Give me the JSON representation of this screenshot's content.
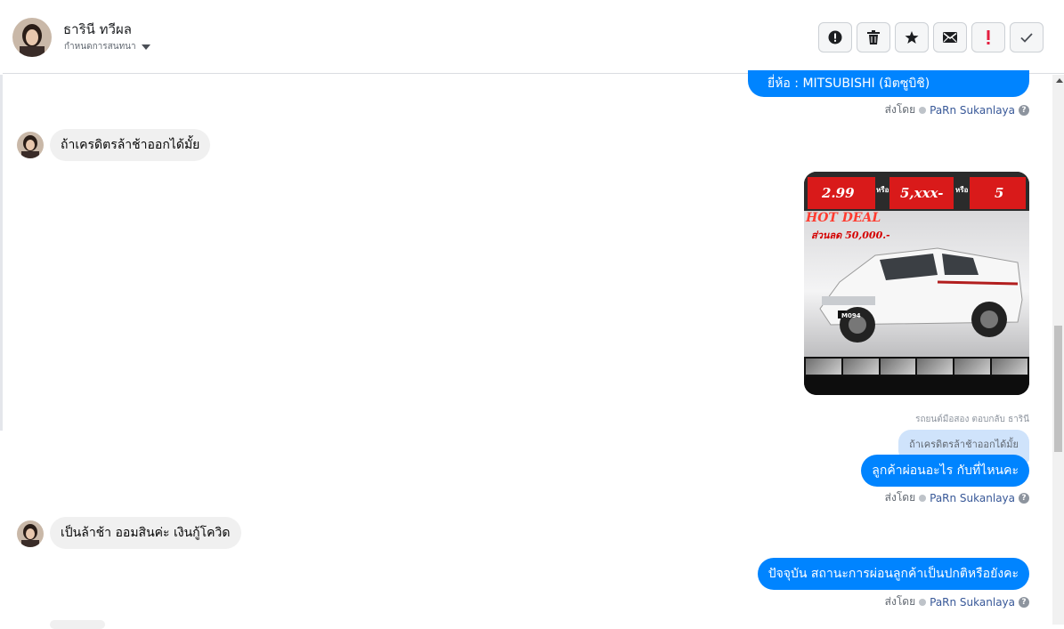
{
  "header": {
    "contact_name": "ธารินี ทวีผล",
    "status": "กำหนดการสนทนา",
    "toolbar": [
      {
        "name": "alert-icon"
      },
      {
        "name": "trash-icon"
      },
      {
        "name": "star-icon"
      },
      {
        "name": "mail-icon"
      },
      {
        "name": "important-icon"
      },
      {
        "name": "check-icon"
      }
    ]
  },
  "messages": {
    "m1": {
      "text": "ยี่ห้อ : MITSUBISHI (มิตซูบิชิ)"
    },
    "m1_sent_by": {
      "prefix": "ส่งโดย",
      "agent": "PaRn Sukanlaya"
    },
    "m2": {
      "text": "ถ้าเครดิตรล้าช้าออกได้มั้ย"
    },
    "image": {
      "promo_top_1": "2.99",
      "promo_top_2": "5,xxx-",
      "promo_top_3": "5",
      "or_label": "หรือ",
      "hot_deal": "HOT DEAL",
      "discount_line": "ส่วนลด 50,000.-",
      "plate": "M094"
    },
    "reply_label": "รถยนต์มือสอง ตอบกลับ ธารินี",
    "quoted": "ถ้าเครดิตรล้าช้าออกได้มั้ย",
    "m3": {
      "text": "ลูกค้าผ่อนอะไร กับที่ไหนคะ"
    },
    "m3_sent_by": {
      "prefix": "ส่งโดย",
      "agent": "PaRn Sukanlaya"
    },
    "m4": {
      "text": "เป็นล้าช้า ออมสินค่ะ เงินกู้โควิด"
    },
    "m5": {
      "text": "ปัจจุบัน สถานะการผ่อนลูกค้าเป็นปกติหรือยังคะ"
    },
    "m5_sent_by": {
      "prefix": "ส่งโดย",
      "agent": "PaRn Sukanlaya"
    }
  },
  "colors": {
    "outgoing_bubble": "#0084ff",
    "incoming_bubble": "#f0f0f0",
    "agent_link": "#385898",
    "important": "#e41e3f"
  }
}
